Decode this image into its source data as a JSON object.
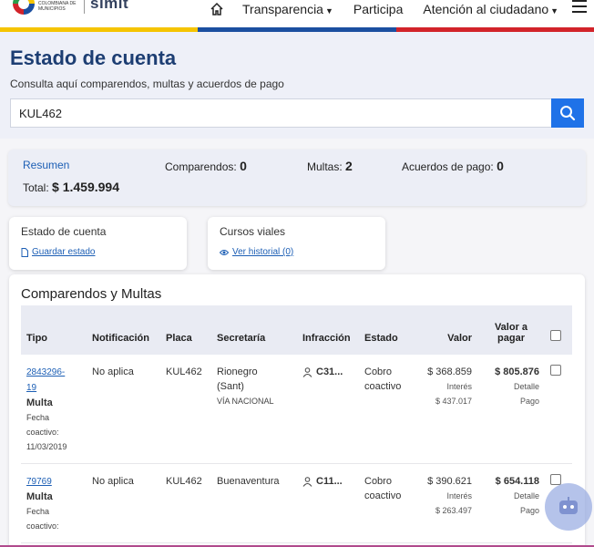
{
  "header": {
    "logo_text": "Federación Colombiana de Municipios",
    "brand": "simit",
    "nav": [
      {
        "label": "Transparencia",
        "dropdown": true
      },
      {
        "label": "Participa",
        "dropdown": false
      },
      {
        "label": "Atención al ciudadano",
        "dropdown": true
      }
    ],
    "icons": {
      "home": "home-icon",
      "menu": "hamburger-icon"
    },
    "stripe_colors": [
      "#f5c400",
      "#1b4fa0",
      "#d2232a"
    ]
  },
  "hero": {
    "title": "Estado de cuenta",
    "subtitle": "Consulta aquí comparendos, multas y acuerdos de pago",
    "search_value": "KUL462",
    "search_icon": "search-icon"
  },
  "summary": {
    "tab_label": "Resumen",
    "comparendos_label": "Comparendos:",
    "comparendos_value": "0",
    "multas_label": "Multas:",
    "multas_value": "2",
    "acuerdos_label": "Acuerdos de pago:",
    "acuerdos_value": "0",
    "total_label": "Total:",
    "total_value": "$ 1.459.994"
  },
  "cards": [
    {
      "title": "Estado de cuenta",
      "link": "Guardar estado",
      "icon": "document-icon"
    },
    {
      "title": "Cursos viales",
      "link": "Ver historial (0)",
      "icon": "eye-icon"
    }
  ],
  "table": {
    "title": "Comparendos y Multas",
    "headers": {
      "tipo": "Tipo",
      "notificacion": "Notificación",
      "placa": "Placa",
      "secretaria": "Secretaría",
      "infraccion": "Infracción",
      "estado": "Estado",
      "valor": "Valor",
      "valor_pagar_1": "Valor a",
      "valor_pagar_2": "pagar"
    },
    "rows": [
      {
        "numero_1": "2843296-",
        "numero_2": "19",
        "tipo": "Multa",
        "fecha_1": "Fecha",
        "fecha_2": "coactivo:",
        "fecha_3": "11/03/2019",
        "notificacion": "No aplica",
        "placa": "KUL462",
        "secretaria_1": "Rionegro",
        "secretaria_2": "(Sant)",
        "secretaria_3": "VÍA NACIONAL",
        "infraccion": "C31...",
        "estado_1": "Cobro",
        "estado_2": "coactivo",
        "valor": "$ 368.859",
        "interes_label": "Interés",
        "interes": "$ 437.017",
        "pagar": "$ 805.876",
        "detalle_1": "Detalle",
        "detalle_2": "Pago"
      },
      {
        "numero_1": "79769",
        "numero_2": "",
        "tipo": "Multa",
        "fecha_1": "Fecha",
        "fecha_2": "coactivo:",
        "fecha_3": "",
        "notificacion": "No aplica",
        "placa": "KUL462",
        "secretaria_1": "Buenaventura",
        "secretaria_2": "",
        "secretaria_3": "",
        "infraccion": "C11...",
        "estado_1": "Cobro",
        "estado_2": "coactivo",
        "valor": "$ 390.621",
        "interes_label": "Interés",
        "interes": "$ 263.497",
        "pagar": "$ 654.118",
        "detalle_1": "Detalle",
        "detalle_2": "Pago"
      }
    ]
  },
  "chatbot_icon": "robot-icon"
}
